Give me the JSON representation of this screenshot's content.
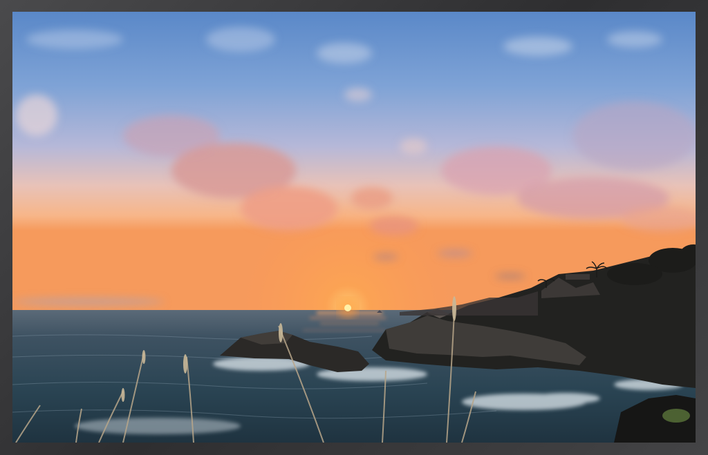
{
  "image": {
    "subject": "sunset-over-ocean",
    "colors": {
      "frame": "#3a3a3c",
      "sky_top": "#5d8bc9",
      "sky_mid": "#b9b6d3",
      "sky_horizon": "#f6a86a",
      "sun": "#ffdf6a",
      "sea_dark": "#233b4a",
      "rock": "#2a2826"
    }
  }
}
